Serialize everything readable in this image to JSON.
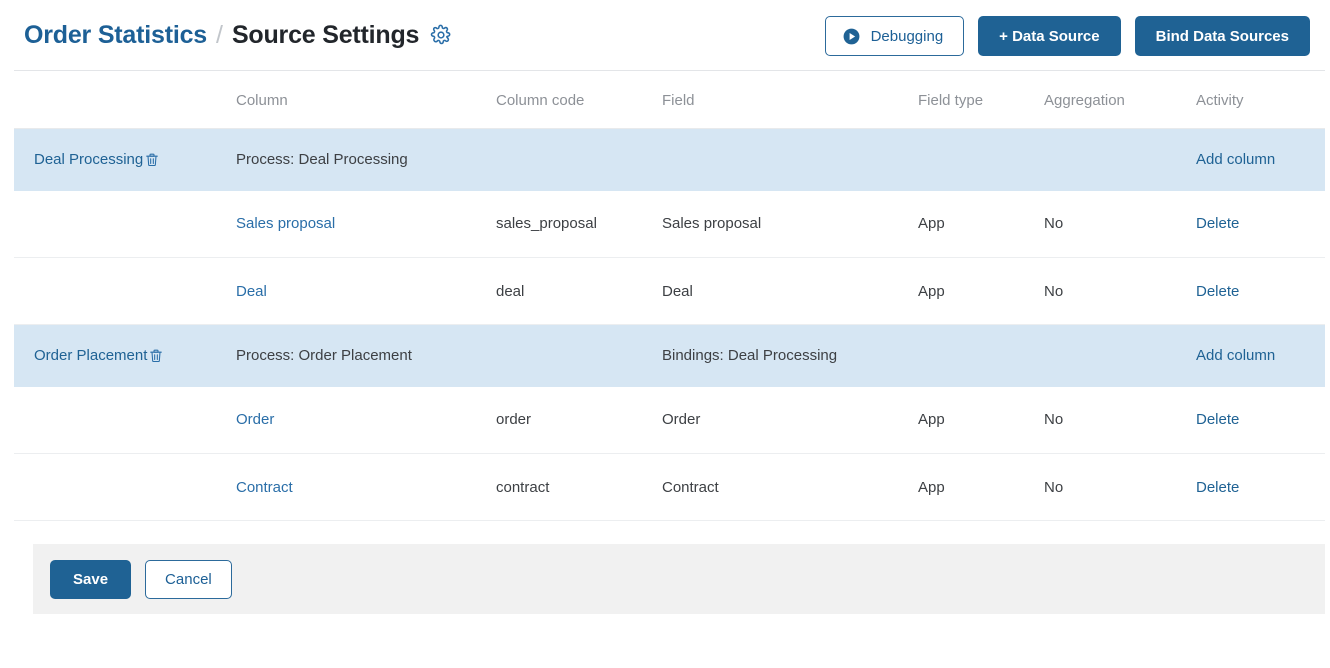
{
  "header": {
    "breadcrumb_parent": "Order Statistics",
    "breadcrumb_separator": "/",
    "breadcrumb_current": "Source Settings",
    "settings_icon": "gear-icon",
    "actions": {
      "debugging_label": "Debugging",
      "debugging_icon": "play-circle-icon",
      "add_data_source_label": "+ Data Source",
      "bind_data_sources_label": "Bind Data Sources"
    }
  },
  "table": {
    "headers": {
      "name": "",
      "column": "Column",
      "column_code": "Column code",
      "field": "Field",
      "field_type": "Field type",
      "aggregation": "Aggregation",
      "activity": "Activity"
    },
    "groups": [
      {
        "name": "Deal Processing",
        "delete_icon": "trash-icon",
        "process": "Process: Deal Processing",
        "bindings": "",
        "add_column_label": "Add column",
        "rows": [
          {
            "column": "Sales proposal",
            "column_code": "sales_proposal",
            "field": "Sales proposal",
            "field_type": "App",
            "aggregation": "No",
            "activity": "Delete"
          },
          {
            "column": "Deal",
            "column_code": "deal",
            "field": "Deal",
            "field_type": "App",
            "aggregation": "No",
            "activity": "Delete"
          }
        ]
      },
      {
        "name": "Order Placement",
        "delete_icon": "trash-icon",
        "process": "Process: Order Placement",
        "bindings": "Bindings: Deal Processing",
        "add_column_label": "Add column",
        "rows": [
          {
            "column": "Order",
            "column_code": "order",
            "field": "Order",
            "field_type": "App",
            "aggregation": "No",
            "activity": "Delete"
          },
          {
            "column": "Contract",
            "column_code": "contract",
            "field": "Contract",
            "field_type": "App",
            "aggregation": "No",
            "activity": "Delete"
          }
        ]
      }
    ]
  },
  "footer": {
    "save_label": "Save",
    "cancel_label": "Cancel"
  },
  "colors": {
    "accent_blue": "#1f6294",
    "link_blue": "#2a6ea8",
    "group_row_bg": "#d6e6f3",
    "footer_bg": "#f1f1f1",
    "header_text": "#8d9197"
  }
}
